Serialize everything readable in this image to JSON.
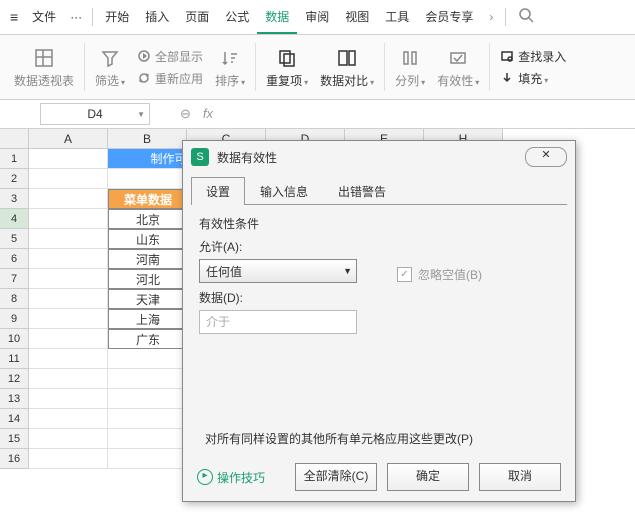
{
  "menu": {
    "file": "文件",
    "items": [
      "开始",
      "插入",
      "页面",
      "公式",
      "数据",
      "审阅",
      "视图",
      "工具",
      "会员专享"
    ],
    "active": 4
  },
  "ribbon": {
    "pivot": "数据透视表",
    "filter": "筛选",
    "showAll": "全部显示",
    "reapply": "重新应用",
    "sort": "排序",
    "dup": "重复项",
    "validate": "数据对比",
    "split": "分列",
    "valid": "有效性",
    "find": "查找录入",
    "fill": "填充"
  },
  "namebox": "D4",
  "colHeaders": [
    "A",
    "B",
    "C",
    "D",
    "E",
    "H"
  ],
  "rows": 16,
  "blueCell": "制作可自动更",
  "orangeCell": "菜单数据",
  "listData": [
    "北京",
    "山东",
    "河南",
    "河北",
    "天津",
    "上海",
    "广东"
  ],
  "dialog": {
    "title": "数据有效性",
    "tabs": [
      "设置",
      "输入信息",
      "出错警告"
    ],
    "activeTab": 0,
    "section": "有效性条件",
    "allowLbl": "允许(A):",
    "allowVal": "任何值",
    "ignoreBlank": "忽略空值(B)",
    "dataLbl": "数据(D):",
    "dataVal": "介于",
    "applyAll": "对所有同样设置的其他所有单元格应用这些更改(P)",
    "tip": "操作技巧",
    "clearAll": "全部清除(C)",
    "ok": "确定",
    "cancel": "取消"
  }
}
